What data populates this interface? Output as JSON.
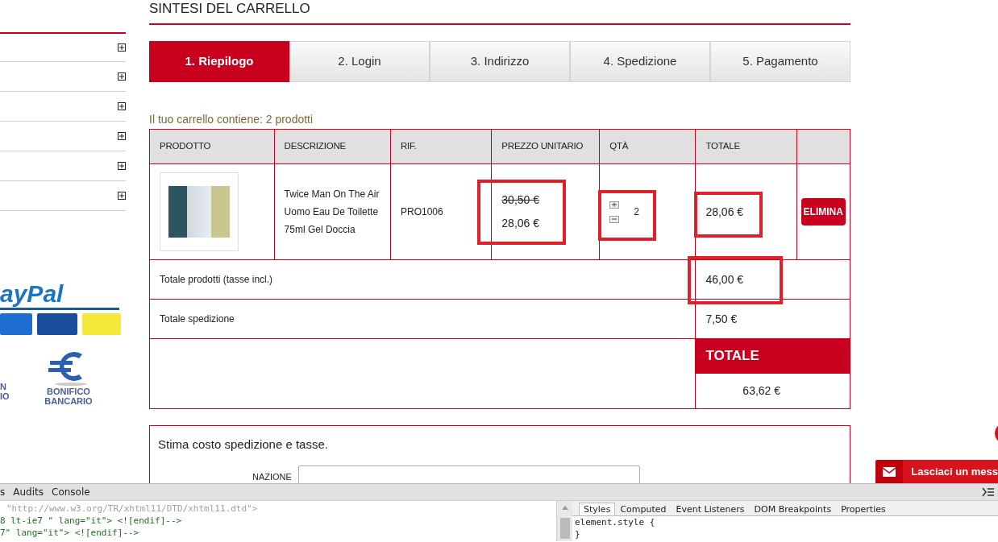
{
  "sidebar": {
    "items": [
      {
        "expanded": false
      },
      {
        "expanded": false
      },
      {
        "expanded": false
      },
      {
        "expanded": false
      },
      {
        "expanded": false
      },
      {
        "expanded": false
      }
    ],
    "payment": {
      "paypal_text": "ayPal",
      "left_fragments": [
        "N",
        "IO"
      ],
      "bank_text": "BONIFICO BANCARIO"
    }
  },
  "title": "SINTESI DEL CARRELLO",
  "steps": [
    {
      "label": "1. Riepilogo",
      "selected": true
    },
    {
      "label": "2. Login",
      "selected": false
    },
    {
      "label": "3. Indirizzo",
      "selected": false
    },
    {
      "label": "4. Spedizione",
      "selected": false
    },
    {
      "label": "5. Pagamento",
      "selected": false
    }
  ],
  "cart_summary": "Il tuo carrello contiene: 2 prodotti",
  "table": {
    "columns": [
      "PRODOTTO",
      "DESCRIZIONE",
      "RIF.",
      "PREZZO UNITARIO",
      "QTÀ",
      "TOTALE"
    ],
    "rows": [
      {
        "description": "Twice Man On The Air Uomo Eau De Toilette 75ml Gel Doccia",
        "ref": "PRO1006",
        "old_price": "30,50 €",
        "price": "28,06 €",
        "price_highlighted": true,
        "qty": "2",
        "qty_highlighted": true,
        "total": "28,06 €",
        "total_highlighted": true,
        "delete": "ELIMINA"
      }
    ],
    "summary": [
      {
        "label": "Totale prodotti (tasse incl.)",
        "value": "46,00 €",
        "highlighted": true
      },
      {
        "label": "Totale spedizione",
        "value": "7,50 €",
        "highlighted": false
      }
    ],
    "grand_total_label": "TOTALE",
    "grand_total": "63,62 €"
  },
  "estimate": {
    "title": "Stima costo spedizione e tasse.",
    "field_label": "NAZIONE"
  },
  "chat": {
    "label": "Lasciaci un mess"
  },
  "devtools": {
    "tabs": [
      {
        "label": "s",
        "selected": false
      },
      {
        "label": "Audits",
        "selected": false
      },
      {
        "label": "Console",
        "selected": false
      }
    ],
    "code": [
      {
        "kind": "doctype",
        "text": "\"http://www.w3.org/TR/xhtml11/DTD/xhtml11.dtd\">"
      },
      {
        "kind": "comment",
        "text": "8 lt-ie7 \" lang=\"it\"> <![endif]-->"
      },
      {
        "kind": "comment",
        "text": "7\" lang=\"it\"> <![endif]-->"
      }
    ],
    "style_tabs": [
      {
        "label": "Styles",
        "selected": true
      },
      {
        "label": "Computed",
        "selected": false
      },
      {
        "label": "Event Listeners",
        "selected": false
      },
      {
        "label": "DOM Breakpoints",
        "selected": false
      },
      {
        "label": "Properties",
        "selected": false
      }
    ],
    "styles": [
      "element.style {",
      "}"
    ]
  }
}
